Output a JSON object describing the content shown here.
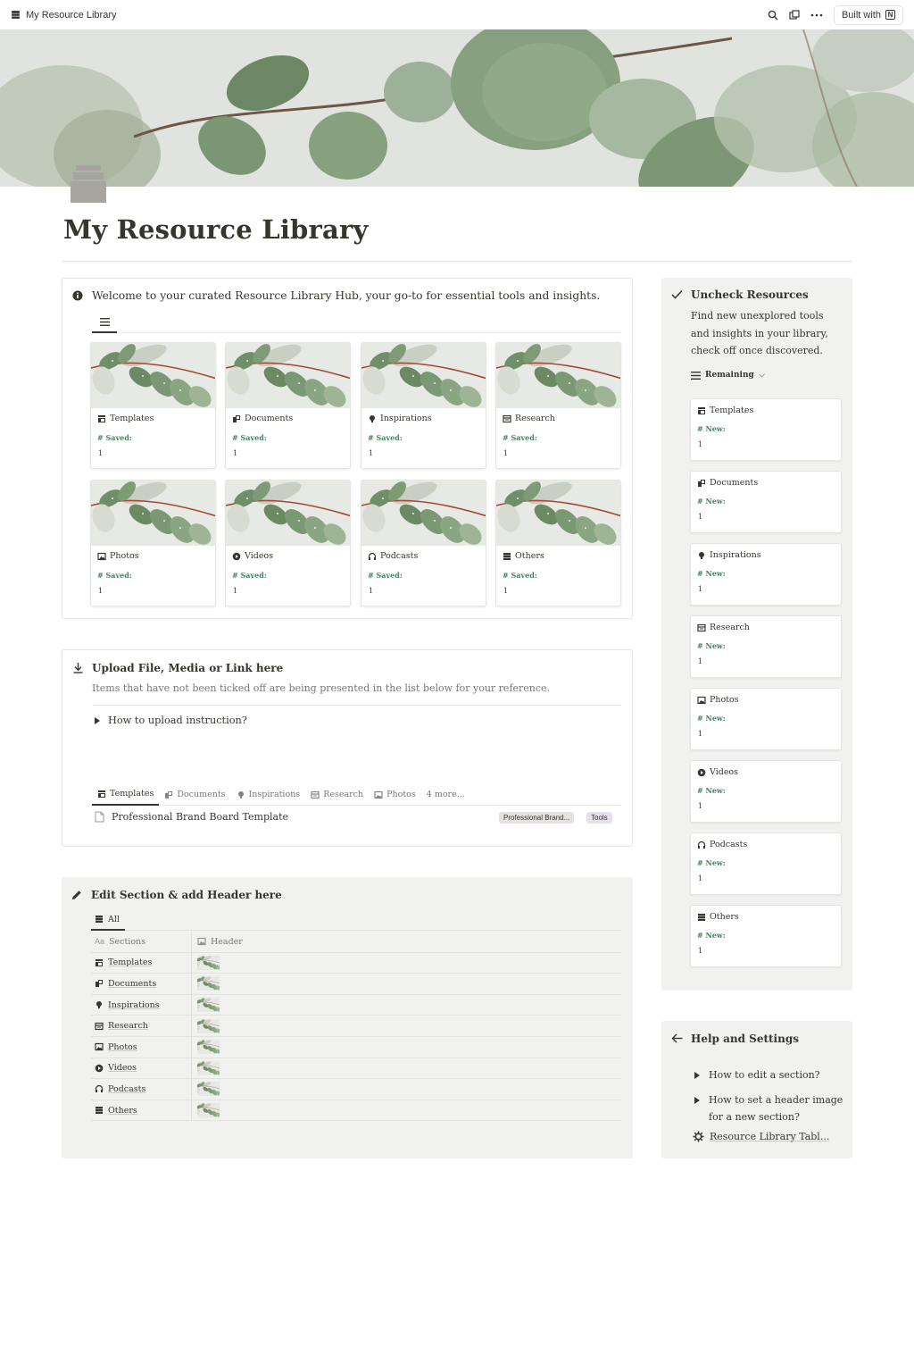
{
  "topbar": {
    "title": "My Resource Library",
    "built_with": "Built with"
  },
  "page": {
    "title": "My Resource Library"
  },
  "welcome": {
    "text": "Welcome to your curated Resource Library Hub, your go-to for essential tools and insights.",
    "cards": [
      {
        "label": "Templates",
        "icon": "templates-icon",
        "prop": "Saved:",
        "value": "1"
      },
      {
        "label": "Documents",
        "icon": "documents-icon",
        "prop": "Saved:",
        "value": "1"
      },
      {
        "label": "Inspirations",
        "icon": "lightbulb-icon",
        "prop": "Saved:",
        "value": "1"
      },
      {
        "label": "Research",
        "icon": "research-icon",
        "prop": "Saved:",
        "value": "1"
      },
      {
        "label": "Photos",
        "icon": "photo-icon",
        "prop": "Saved:",
        "value": "1"
      },
      {
        "label": "Videos",
        "icon": "play-icon",
        "prop": "Saved:",
        "value": "1"
      },
      {
        "label": "Podcasts",
        "icon": "headphones-icon",
        "prop": "Saved:",
        "value": "1"
      },
      {
        "label": "Others",
        "icon": "archive-icon",
        "prop": "Saved:",
        "value": "1"
      }
    ]
  },
  "upload": {
    "title": "Upload File, Media or Link here",
    "description": "Items that have not been ticked off are being presented in the list below for your reference.",
    "toggle": "How to upload instruction?",
    "tabs": [
      "Templates",
      "Documents",
      "Inspirations",
      "Research",
      "Photos"
    ],
    "more": "4 more...",
    "item": {
      "name": "Professional Brand Board Template",
      "tag1": "Professional Brand...",
      "tag2": "Tools"
    }
  },
  "edit": {
    "title": "Edit Section & add Header here",
    "view": "All",
    "col_sections": "Sections",
    "col_header": "Header",
    "rows": [
      "Templates",
      "Documents",
      "Inspirations",
      "Research",
      "Photos",
      "Videos",
      "Podcasts",
      "Others"
    ]
  },
  "sidebar": {
    "title": "Uncheck Resources",
    "description": "Find new unexplored tools and insights in your library, check off once discovered.",
    "view": "Remaining",
    "cards": [
      {
        "label": "Templates",
        "prop": "New:",
        "value": "1"
      },
      {
        "label": "Documents",
        "prop": "New:",
        "value": "1"
      },
      {
        "label": "Inspirations",
        "prop": "New:",
        "value": "1"
      },
      {
        "label": "Research",
        "prop": "New:",
        "value": "1"
      },
      {
        "label": "Photos",
        "prop": "New:",
        "value": "1"
      },
      {
        "label": "Videos",
        "prop": "New:",
        "value": "1"
      },
      {
        "label": "Podcasts",
        "prop": "New:",
        "value": "1"
      },
      {
        "label": "Others",
        "prop": "New:",
        "value": "1"
      }
    ]
  },
  "help": {
    "title": "Help and Settings",
    "toggle1": "How to edit a section?",
    "toggle2_line1": "How to set a header image",
    "toggle2_line2": "for a new section?",
    "link": "Resource Library Tabl..."
  },
  "colors": {
    "text": "#37352f",
    "muted": "#787774",
    "green": "#448361",
    "gray_bg": "#f1f1ef",
    "tag_purple": "#e8deee"
  }
}
